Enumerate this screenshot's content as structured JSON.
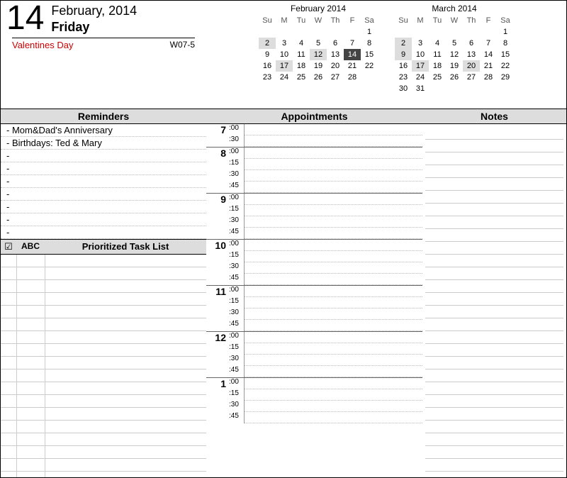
{
  "date": {
    "day_number": "14",
    "month_year": "February, 2014",
    "day_name": "Friday",
    "holiday": "Valentines Day",
    "week_code": "W07-5"
  },
  "mini_calendars": [
    {
      "title": "February 2014",
      "dow": [
        "Su",
        "M",
        "Tu",
        "W",
        "Th",
        "F",
        "Sa"
      ],
      "rows": [
        [
          {
            "t": ""
          },
          {
            "t": ""
          },
          {
            "t": ""
          },
          {
            "t": ""
          },
          {
            "t": ""
          },
          {
            "t": ""
          },
          {
            "t": "1"
          }
        ],
        [
          {
            "t": "2",
            "c": "hl"
          },
          {
            "t": "3"
          },
          {
            "t": "4"
          },
          {
            "t": "5"
          },
          {
            "t": "6"
          },
          {
            "t": "7"
          },
          {
            "t": "8"
          }
        ],
        [
          {
            "t": "9"
          },
          {
            "t": "10"
          },
          {
            "t": "11"
          },
          {
            "t": "12",
            "c": "hl"
          },
          {
            "t": "13"
          },
          {
            "t": "14",
            "c": "sel"
          },
          {
            "t": "15"
          }
        ],
        [
          {
            "t": "16"
          },
          {
            "t": "17",
            "c": "hl"
          },
          {
            "t": "18"
          },
          {
            "t": "19"
          },
          {
            "t": "20"
          },
          {
            "t": "21"
          },
          {
            "t": "22"
          }
        ],
        [
          {
            "t": "23"
          },
          {
            "t": "24"
          },
          {
            "t": "25"
          },
          {
            "t": "26"
          },
          {
            "t": "27"
          },
          {
            "t": "28"
          },
          {
            "t": ""
          }
        ],
        [
          {
            "t": ""
          },
          {
            "t": ""
          },
          {
            "t": ""
          },
          {
            "t": ""
          },
          {
            "t": ""
          },
          {
            "t": ""
          },
          {
            "t": ""
          }
        ]
      ]
    },
    {
      "title": "March 2014",
      "dow": [
        "Su",
        "M",
        "Tu",
        "W",
        "Th",
        "F",
        "Sa"
      ],
      "rows": [
        [
          {
            "t": ""
          },
          {
            "t": ""
          },
          {
            "t": ""
          },
          {
            "t": ""
          },
          {
            "t": ""
          },
          {
            "t": ""
          },
          {
            "t": "1"
          }
        ],
        [
          {
            "t": "2",
            "c": "hl"
          },
          {
            "t": "3"
          },
          {
            "t": "4"
          },
          {
            "t": "5"
          },
          {
            "t": "6"
          },
          {
            "t": "7"
          },
          {
            "t": "8"
          }
        ],
        [
          {
            "t": "9",
            "c": "hl"
          },
          {
            "t": "10"
          },
          {
            "t": "11"
          },
          {
            "t": "12"
          },
          {
            "t": "13"
          },
          {
            "t": "14"
          },
          {
            "t": "15"
          }
        ],
        [
          {
            "t": "16"
          },
          {
            "t": "17",
            "c": "hl"
          },
          {
            "t": "18"
          },
          {
            "t": "19"
          },
          {
            "t": "20",
            "c": "hl"
          },
          {
            "t": "21"
          },
          {
            "t": "22"
          }
        ],
        [
          {
            "t": "23"
          },
          {
            "t": "24"
          },
          {
            "t": "25"
          },
          {
            "t": "26"
          },
          {
            "t": "27"
          },
          {
            "t": "28"
          },
          {
            "t": "29"
          }
        ],
        [
          {
            "t": "30"
          },
          {
            "t": "31"
          },
          {
            "t": ""
          },
          {
            "t": ""
          },
          {
            "t": ""
          },
          {
            "t": ""
          },
          {
            "t": ""
          }
        ]
      ]
    }
  ],
  "sections": {
    "reminders": "Reminders",
    "appointments": "Appointments",
    "notes": "Notes",
    "tasks": "Prioritized Task List",
    "abc": "ABC",
    "check": "☑"
  },
  "reminders": [
    "- Mom&Dad's Anniversary",
    "- Birthdays: Ted & Mary",
    "-",
    "-",
    "-",
    "-",
    "-",
    "-",
    "-"
  ],
  "hours": [
    {
      "h": "7",
      "mins": [
        ":00",
        ":30"
      ]
    },
    {
      "h": "8",
      "mins": [
        ":00",
        ":15",
        ":30",
        ":45"
      ]
    },
    {
      "h": "9",
      "mins": [
        ":00",
        ":15",
        ":30",
        ":45"
      ]
    },
    {
      "h": "10",
      "mins": [
        ":00",
        ":15",
        ":30",
        ":45"
      ]
    },
    {
      "h": "11",
      "mins": [
        ":00",
        ":15",
        ":30",
        ":45"
      ]
    },
    {
      "h": "12",
      "mins": [
        ":00",
        ":15",
        ":30",
        ":45"
      ]
    },
    {
      "h": "1",
      "mins": [
        ":00",
        ":15",
        ":30",
        ":45"
      ]
    }
  ]
}
